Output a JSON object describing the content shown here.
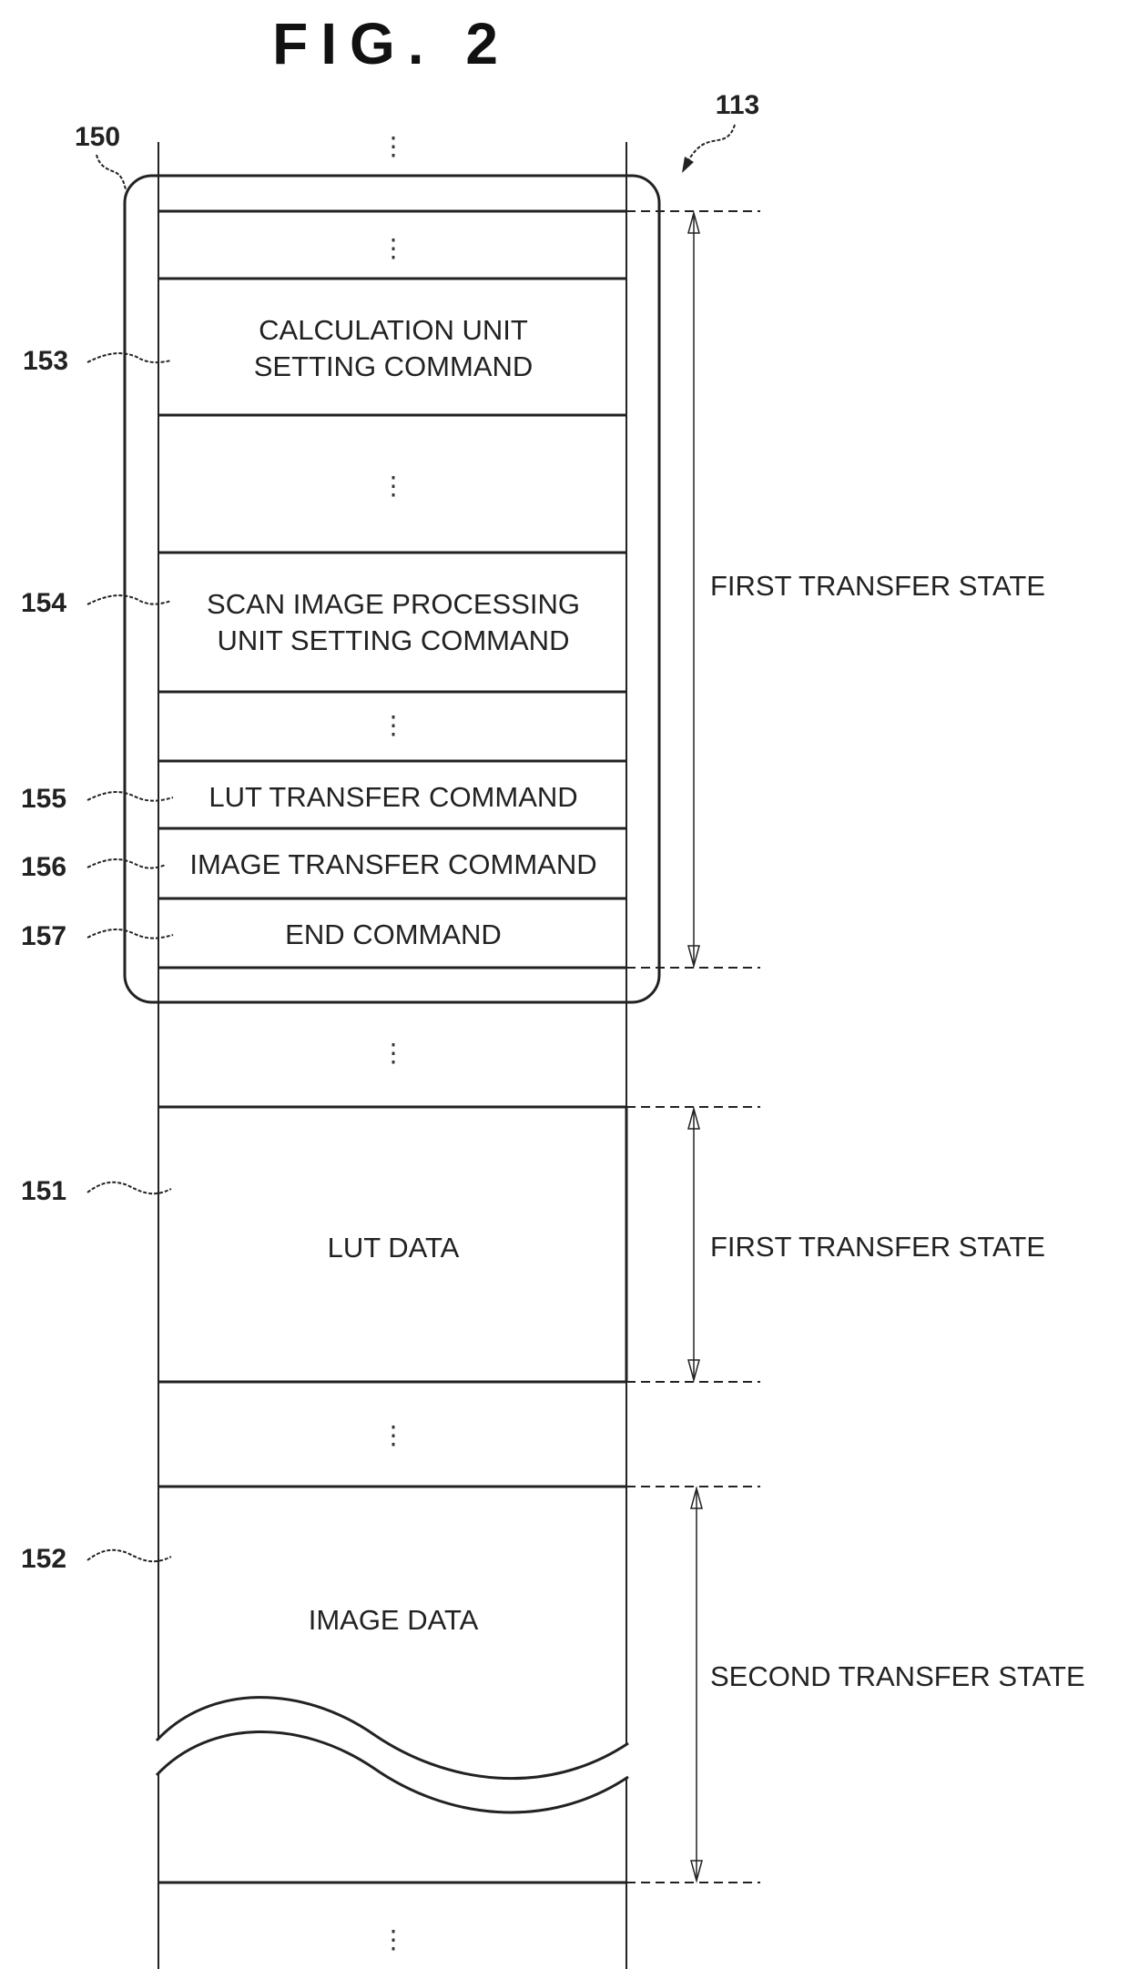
{
  "figure": {
    "title": "FIG. 2",
    "memory_ref": "113",
    "command_group_ref": "150"
  },
  "rows": {
    "ellipsis": "⋮",
    "calc_ref": "153",
    "calc_line1": "CALCULATION UNIT",
    "calc_line2": "SETTING COMMAND",
    "scan_ref": "154",
    "scan_line1": "SCAN IMAGE PROCESSING",
    "scan_line2": "UNIT SETTING COMMAND",
    "lut_cmd_ref": "155",
    "lut_cmd": "LUT TRANSFER COMMAND",
    "img_cmd_ref": "156",
    "img_cmd": "IMAGE TRANSFER COMMAND",
    "end_ref": "157",
    "end_cmd": "END COMMAND",
    "lut_data_ref": "151",
    "lut_data": "LUT DATA",
    "img_data_ref": "152",
    "img_data": "IMAGE DATA"
  },
  "states": {
    "commands": "FIRST TRANSFER STATE",
    "lut": "FIRST TRANSFER STATE",
    "image": "SECOND TRANSFER STATE"
  }
}
